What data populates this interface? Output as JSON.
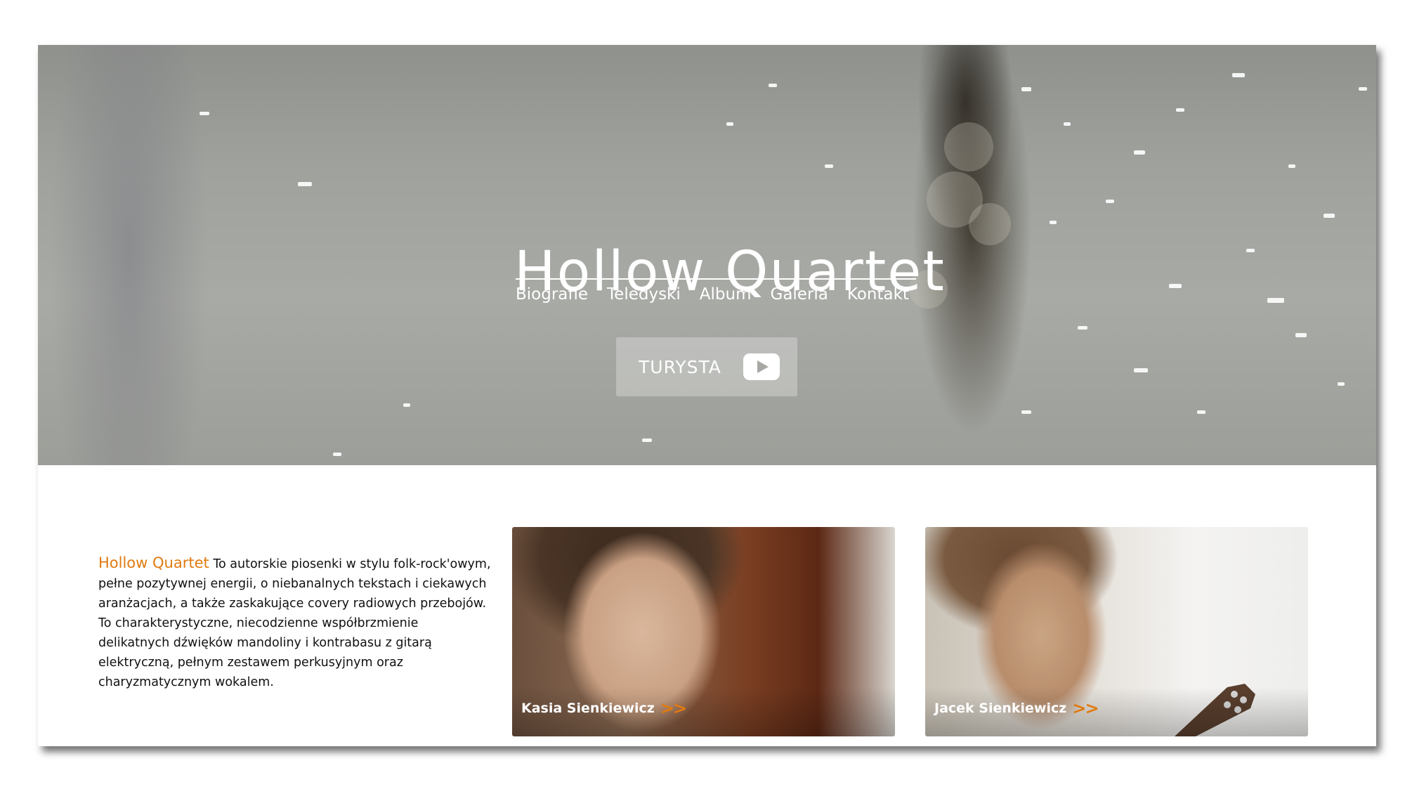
{
  "hero": {
    "title": "Hollow Quartet",
    "nav": [
      "Biografie",
      "Teledyski",
      "Album",
      "Galeria",
      "Kontakt"
    ],
    "video_button": {
      "label": "TURYSTA",
      "icon": "youtube-play-icon"
    }
  },
  "intro": {
    "brand": "Hollow Quartet",
    "text": " To autorskie piosenki w stylu folk-rock'owym, pełne pozytywnej energii, o niebanalnych tekstach i ciekawych aranżacjach, a także zaskakujące covery radiowych przebojów. To charakterystyczne, niecodzienne współbrzmienie delikatnych dźwięków mandoliny i kontrabasu z gitarą elektryczną, pełnym zestawem perkusyjnym oraz charyzmatycznym wokalem."
  },
  "members": [
    {
      "name": "Kasia Sienkiewicz",
      "arrow": ">>"
    },
    {
      "name": "Jacek Sienkiewicz",
      "arrow": ">>"
    }
  ],
  "colors": {
    "accent": "#e07a10",
    "text": "#111111",
    "hero_text": "#ffffff"
  }
}
